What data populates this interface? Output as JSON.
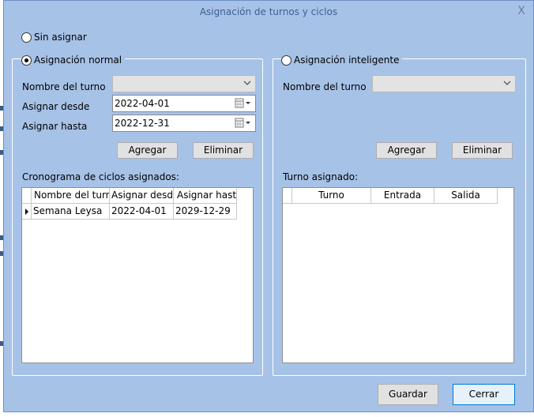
{
  "window": {
    "title": "Asignación de turnos y ciclos",
    "close_glyph": "X"
  },
  "options": {
    "sin_asignar": "Sin asignar",
    "normal": "Asignación normal",
    "inteligente": "Asignación inteligente",
    "selected": "normal"
  },
  "normal": {
    "turno_label": "Nombre del turno",
    "turno_value": "",
    "desde_label": "Asignar desde",
    "desde_value": "2022-04-01",
    "hasta_label": "Asignar hasta",
    "hasta_value": "2022-12-31",
    "agregar": "Agregar",
    "eliminar": "Eliminar",
    "cronograma_label": "Cronograma de ciclos asignados:",
    "columns": [
      "Nombre del turno",
      "Asignar desde",
      "Asignar hasta"
    ],
    "rows": [
      [
        "Semana Leysa",
        "2022-04-01",
        "2029-12-29"
      ]
    ]
  },
  "inteligente": {
    "turno_label": "Nombre del turno",
    "turno_value": "",
    "agregar": "Agregar",
    "eliminar": "Eliminar",
    "asignado_label": "Turno asignado:",
    "columns": [
      "Turno",
      "Entrada",
      "Salida"
    ]
  },
  "footer": {
    "guardar": "Guardar",
    "cerrar": "Cerrar"
  },
  "icons": {
    "dropdown": "chevron-down-icon",
    "calendar": "calendar-icon",
    "row_pointer": "row-pointer-icon",
    "close": "close-icon"
  }
}
